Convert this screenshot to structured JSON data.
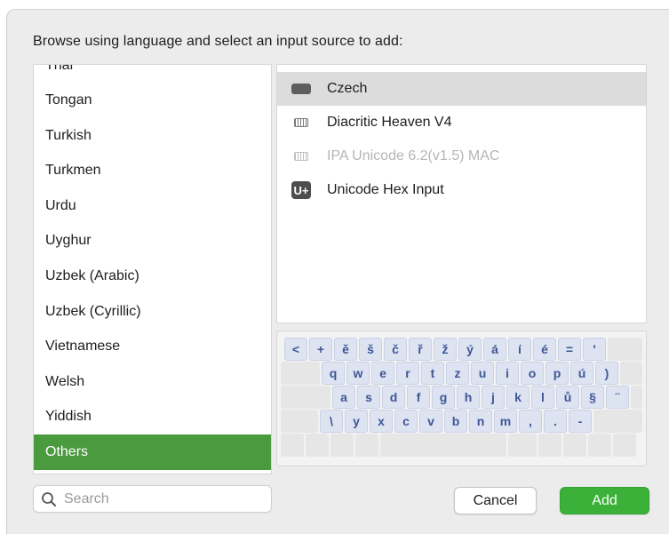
{
  "dialog": {
    "prompt": "Browse using language and select an input source to add:"
  },
  "languages": {
    "partial_top": "Thai",
    "items": [
      {
        "label": "Tongan",
        "selected": false
      },
      {
        "label": "Turkish",
        "selected": false
      },
      {
        "label": "Turkmen",
        "selected": false
      },
      {
        "label": "Urdu",
        "selected": false
      },
      {
        "label": "Uyghur",
        "selected": false
      },
      {
        "label": "Uzbek (Arabic)",
        "selected": false
      },
      {
        "label": "Uzbek (Cyrillic)",
        "selected": false
      },
      {
        "label": "Vietnamese",
        "selected": false
      },
      {
        "label": "Welsh",
        "selected": false
      },
      {
        "label": "Yiddish",
        "selected": false
      },
      {
        "label": "Others",
        "selected": true
      }
    ],
    "selected_color": "#4a9a3e"
  },
  "sources": {
    "items": [
      {
        "label": "Czech",
        "icon": "flag-icon",
        "selected": true,
        "enabled": true
      },
      {
        "label": "Diacritic Heaven V4",
        "icon": "keyboard-icon",
        "selected": false,
        "enabled": true
      },
      {
        "label": "IPA Unicode 6.2(v1.5) MAC",
        "icon": "keyboard-icon",
        "selected": false,
        "enabled": false
      },
      {
        "label": "Unicode Hex Input",
        "icon": "unicode-icon",
        "selected": false,
        "enabled": true
      }
    ],
    "unicode_icon_text": "U+"
  },
  "keyboard_preview": {
    "rows": [
      [
        "<",
        "+",
        "ě",
        "š",
        "č",
        "ř",
        "ž",
        "ý",
        "á",
        "í",
        "é",
        "=",
        "'"
      ],
      [
        "q",
        "w",
        "e",
        "r",
        "t",
        "z",
        "u",
        "i",
        "o",
        "p",
        "ú",
        ")"
      ],
      [
        "a",
        "s",
        "d",
        "f",
        "g",
        "h",
        "j",
        "k",
        "l",
        "ů",
        "§",
        "¨"
      ],
      [
        "\\",
        "y",
        "x",
        "c",
        "v",
        "b",
        "n",
        "m",
        ",",
        ".",
        "-"
      ]
    ],
    "key_text_color": "#3e5795"
  },
  "search": {
    "placeholder": "Search",
    "value": ""
  },
  "buttons": {
    "cancel_label": "Cancel",
    "add_label": "Add",
    "add_color": "#3bb139"
  }
}
